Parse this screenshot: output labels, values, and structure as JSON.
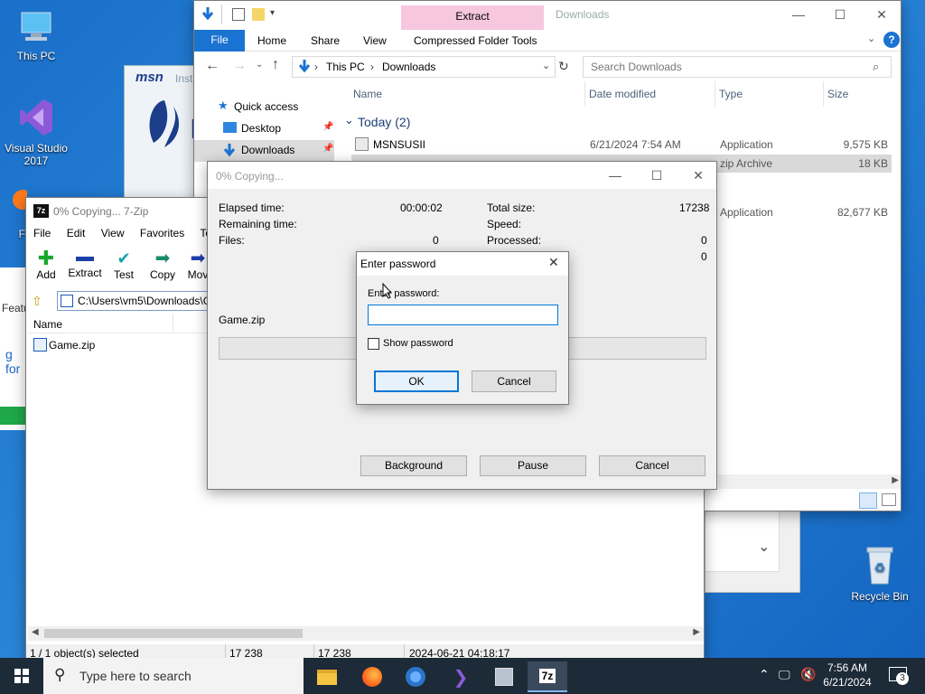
{
  "desktop": {
    "icons": [
      {
        "label": "This PC"
      },
      {
        "label": "Visual Studio 2017"
      },
      {
        "label": "F"
      },
      {
        "label": "Recycle Bin"
      }
    ],
    "msn_label": "msn",
    "msn_fragment": "Inst",
    "side_fragments": [
      "Featu",
      "g for"
    ]
  },
  "explorer": {
    "title": "Downloads",
    "ribbon_tabs": [
      "File",
      "Home",
      "Share",
      "View"
    ],
    "context_tab_top": "Extract",
    "context_tab": "Compressed Folder Tools",
    "address": [
      "This PC",
      "Downloads"
    ],
    "search_placeholder": "Search Downloads",
    "nav": [
      "Quick access",
      "Desktop",
      "Downloads"
    ],
    "columns": [
      "Name",
      "Date modified",
      "Type",
      "Size"
    ],
    "group": "Today (2)",
    "files": [
      {
        "name": "MSNSUSII",
        "date": "6/21/2024 7:54 AM",
        "type": "Application",
        "size": "9,575 KB"
      },
      {
        "name": "",
        "date": "",
        "type": "zip Archive",
        "size": "18 KB"
      },
      {
        "name": "",
        "date": "",
        "type": "Application",
        "size": "82,677 KB"
      }
    ]
  },
  "sevenzip": {
    "title": "0% Copying... 7-Zip",
    "menu": [
      "File",
      "Edit",
      "View",
      "Favorites",
      "Tools"
    ],
    "toolbar": [
      "Add",
      "Extract",
      "Test",
      "Copy",
      "Mov"
    ],
    "path": "C:\\Users\\vm5\\Downloads\\G",
    "column_name": "Name",
    "file": "Game.zip",
    "status": [
      "1 / 1 object(s) selected",
      "17 238",
      "17 238",
      "2024-06-21 04:18:17"
    ]
  },
  "copying": {
    "title": "0% Copying...",
    "elapsed_label": "Elapsed time:",
    "elapsed": "00:00:02",
    "remaining_label": "Remaining time:",
    "files_label": "Files:",
    "files": "0",
    "total_label": "Total size:",
    "total": "17238",
    "speed_label": "Speed:",
    "processed_label": "Processed:",
    "processed": "0",
    "extra_value": "0",
    "current_file": "Game.zip",
    "progress": 0,
    "buttons": [
      "Background",
      "Pause",
      "Cancel"
    ]
  },
  "password": {
    "title": "Enter password",
    "label": "Enter password:",
    "value": "",
    "show_label": "Show password",
    "ok": "OK",
    "cancel": "Cancel"
  },
  "taskbar": {
    "search_placeholder": "Type here to search",
    "app_7z": "7z",
    "time": "7:56 AM",
    "date": "6/21/2024",
    "notif_count": "3"
  }
}
